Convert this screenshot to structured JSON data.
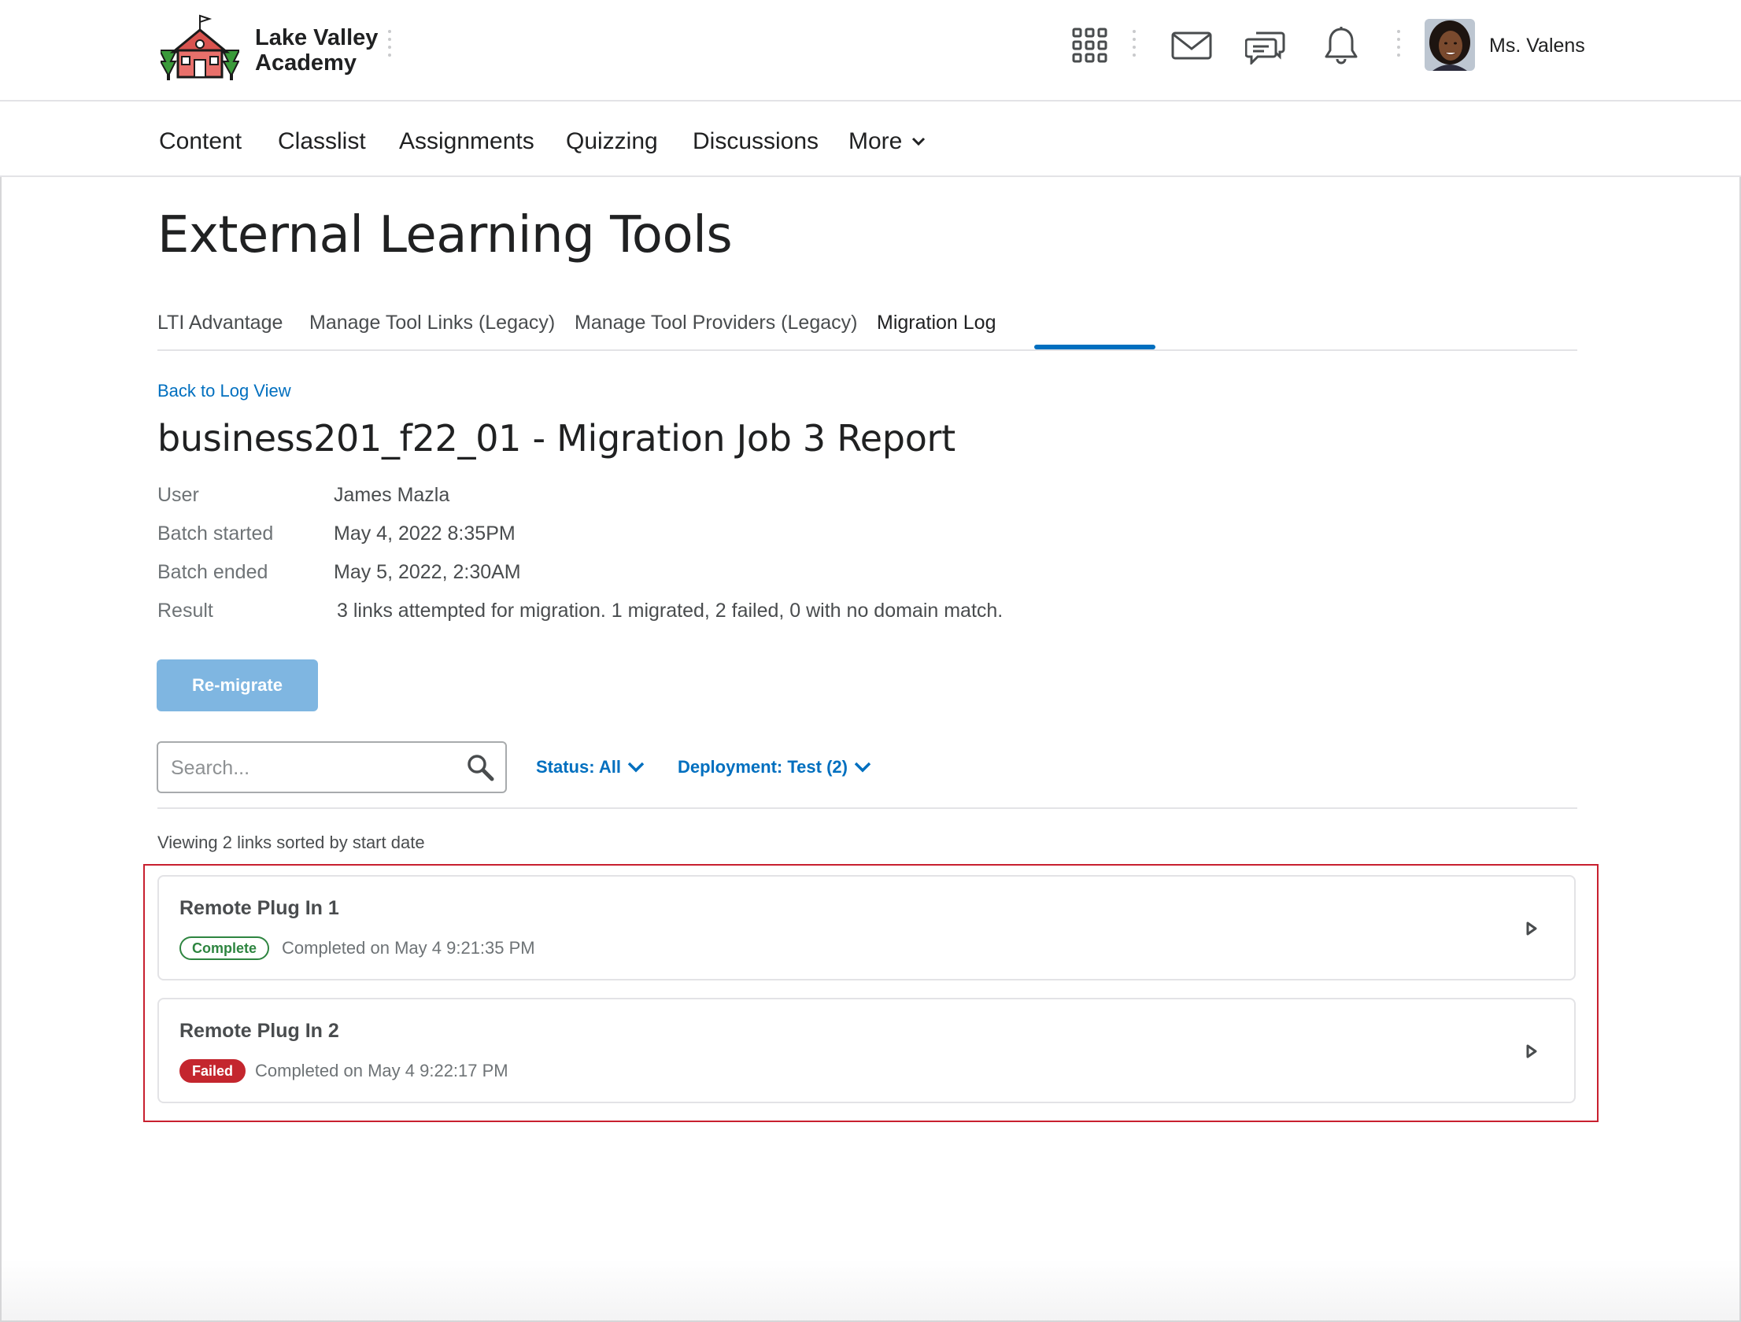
{
  "app": {
    "school_name_line1": "Lake Valley",
    "school_name_line2": "Academy",
    "user_name": "Ms. Valens"
  },
  "header_icons": [
    "apps-grid-icon",
    "mail-icon",
    "chat-icon",
    "bell-icon"
  ],
  "nav": {
    "items": [
      "Content",
      "Classlist",
      "Assignments",
      "Quizzing",
      "Discussions",
      "More"
    ]
  },
  "page": {
    "title": "External Learning Tools",
    "tabs": [
      "LTI Advantage",
      "Manage Tool Links (Legacy)",
      "Manage Tool Providers (Legacy)",
      "Migration Log"
    ],
    "active_tab": "Migration Log",
    "back_link": "Back to Log View",
    "report_title": "business201_f22_01 - Migration Job 3 Report"
  },
  "meta": [
    {
      "label": "User",
      "value": "James Mazla"
    },
    {
      "label": "Batch started",
      "value": "May 4, 2022 8:35PM"
    },
    {
      "label": "Batch ended",
      "value": "May 5, 2022, 2:30AM"
    },
    {
      "label": "Result",
      "value": "3 links attempted for migration. 1 migrated, 2 failed, 0 with no domain match."
    }
  ],
  "actions": {
    "remigrate_label": "Re-migrate"
  },
  "search": {
    "placeholder": "Search...",
    "value": ""
  },
  "filters": {
    "status": "Status: All",
    "deployment": "Deployment: Test (2)"
  },
  "list": {
    "summary": "Viewing 2 links sorted by start date",
    "items": [
      {
        "title": "Remote Plug In 1",
        "status": "Complete",
        "completed": "Completed on May 4 9:21:35 PM"
      },
      {
        "title": "Remote Plug In 2",
        "status": "Failed",
        "completed": "Completed on May 4 9:22:17 PM"
      }
    ]
  },
  "colors": {
    "link_blue": "#006fbf",
    "button_disabled_blue": "#7fb6e1",
    "complete_green": "#2e8540",
    "failed_red": "#c4262e",
    "highlight_red": "#c8202f"
  }
}
